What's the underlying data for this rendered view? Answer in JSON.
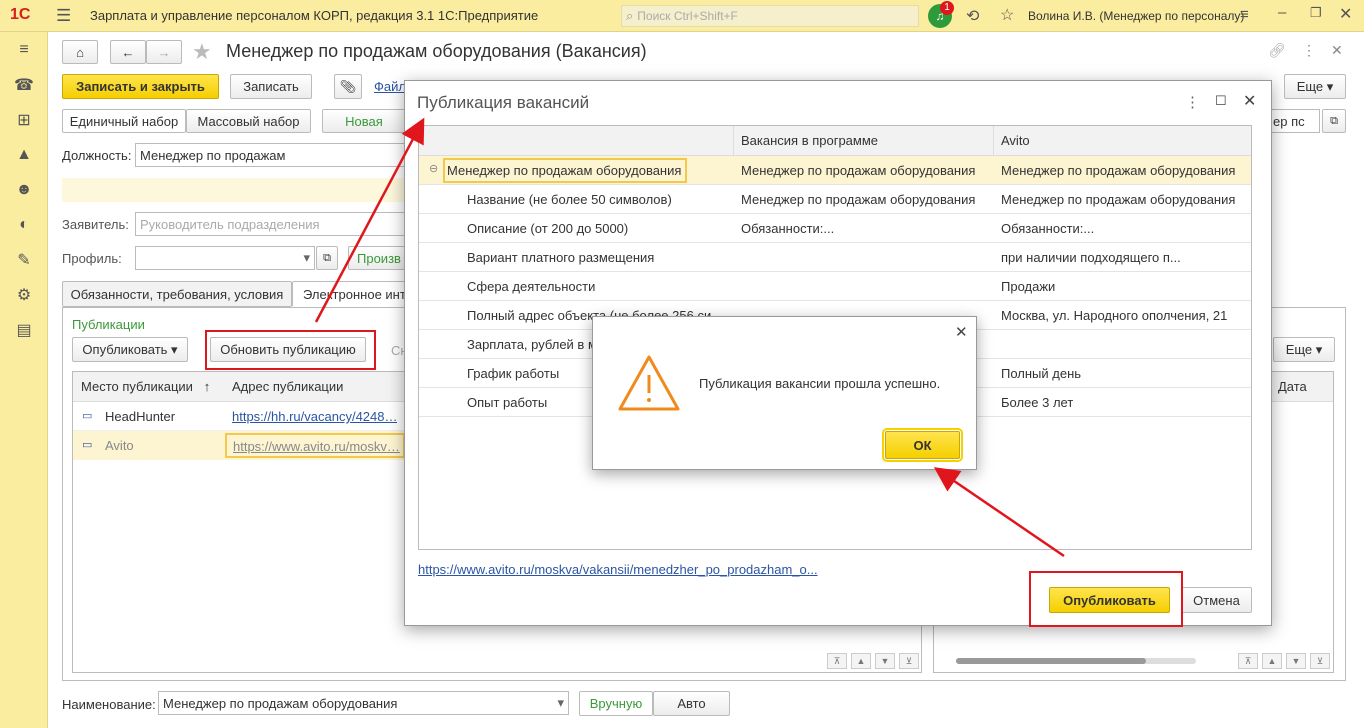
{
  "app": {
    "logo": "1С",
    "title": "Зарплата и управление персоналом КОРП, редакция 3.1 1С:Предприятие",
    "search_placeholder": "Поиск Ctrl+Shift+F",
    "notif_count": "1",
    "user": "Волина И.В. (Менеджер по персоналу)"
  },
  "doc": {
    "title": "Менеджер по продажам оборудования (Вакансия)",
    "save_close": "Записать и закрыть",
    "save": "Записать",
    "files": "Файл",
    "more": "Еще",
    "set_single": "Единичный набор",
    "set_mass": "Массовый набор",
    "new": "Новая",
    "right_field": "ер пс"
  },
  "form": {
    "position_label": "Должность:",
    "position_value": "Менеджер по продажам",
    "applicant_label": "Заявитель:",
    "applicant_placeholder": "Руководитель подразделения",
    "profile_label": "Профиль:",
    "produce_link": "Произв"
  },
  "tabs": {
    "duties": "Обязанности, требования, условия",
    "electronic": "Электронное инте"
  },
  "pub": {
    "section": "Публикации",
    "publish_btn": "Опубликовать",
    "update_btn": "Обновить публикацию",
    "cut_btn": "Сн",
    "more": "Еще",
    "date_col": "Дата",
    "col_place": "Место публикации",
    "col_address": "Адрес публикации",
    "rows": [
      {
        "place": "HeadHunter",
        "address": "https://hh.ru/vacancy/4248…"
      },
      {
        "place": "Avito",
        "address": "https://www.avito.ru/moskv…"
      }
    ]
  },
  "bottom": {
    "name_label": "Наименование:",
    "name_value": "Менеджер по продажам оборудования",
    "manual": "Вручную",
    "auto": "Авто"
  },
  "dialog": {
    "title": "Публикация вакансий",
    "col_prog": "Вакансия в программе",
    "col_avito": "Avito",
    "rows": [
      {
        "name": "Менеджер по продажам оборудования",
        "prog": "Менеджер по продажам оборудования",
        "avito": "Менеджер по продажам оборудования"
      },
      {
        "name": "Название (не более 50 символов)",
        "prog": "Менеджер по продажам оборудования",
        "avito": "Менеджер по продажам оборудования"
      },
      {
        "name": "Описание (от 200 до 5000)",
        "prog": "Обязанности:...",
        "avito": "Обязанности:..."
      },
      {
        "name": "Вариант платного размещения",
        "prog": "",
        "avito": "при наличии подходящего п..."
      },
      {
        "name": "Сфера деятельности",
        "prog": "",
        "avito": "Продажи"
      },
      {
        "name": "Полный адрес объекта (не более 256 си",
        "prog": "",
        "avito": "Москва, ул. Народного ополчения, 21"
      },
      {
        "name": "Зарплата, рублей в м",
        "prog": "",
        "avito": ""
      },
      {
        "name": "График работы",
        "prog": "",
        "avito": "Полный день"
      },
      {
        "name": "Опыт работы",
        "prog": "",
        "avito": "Более 3 лет"
      }
    ],
    "link": "https://www.avito.ru/moskva/vakansii/menedzher_po_prodazham_o...",
    "publish": "Опубликовать",
    "cancel": "Отмена"
  },
  "msg": {
    "text": "Публикация вакансии прошла успешно.",
    "ok": "ОК"
  },
  "colors": {
    "accent_yellow": "#f5cf00",
    "annotation_red": "#e0161d",
    "link": "#2a55a5"
  }
}
